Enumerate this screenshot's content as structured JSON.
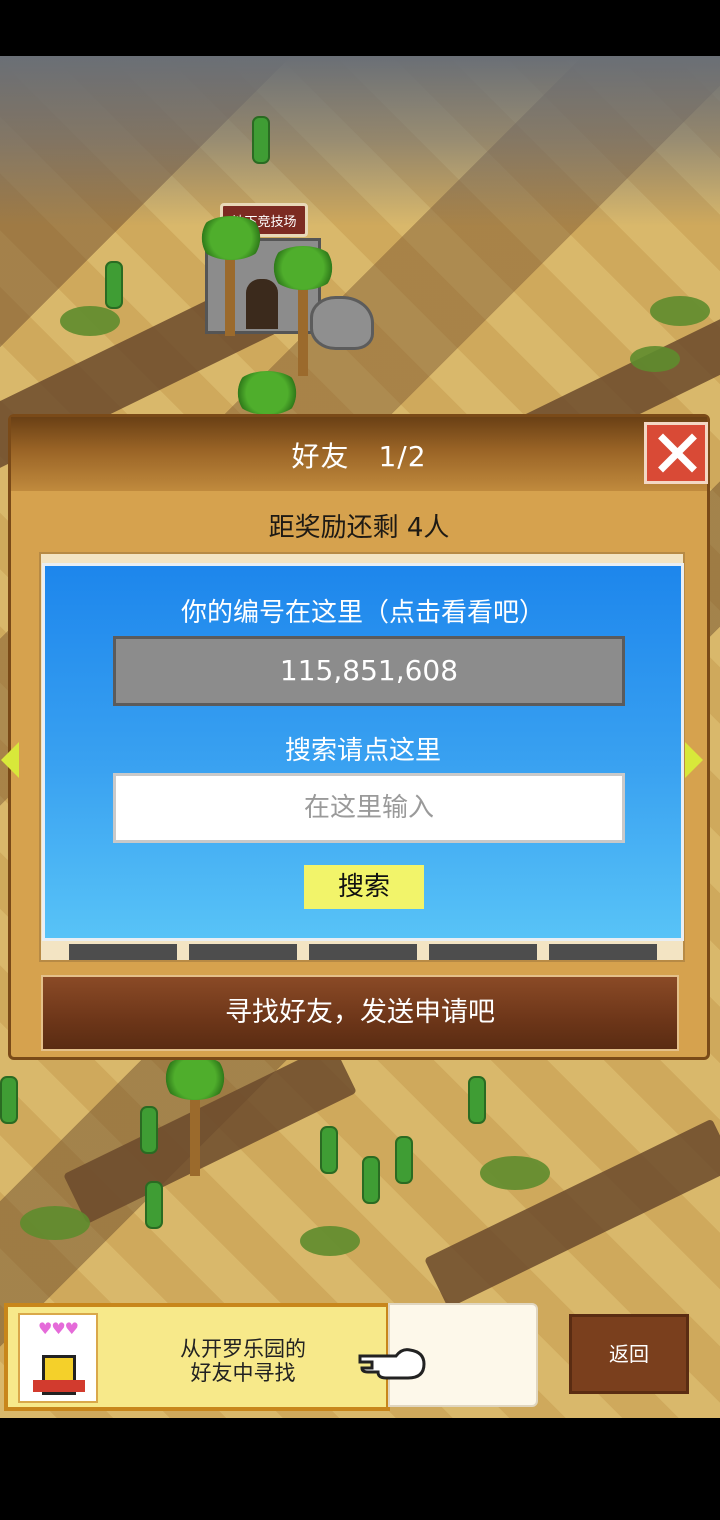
{
  "world": {
    "building_sign": "地下竞技场"
  },
  "dialog": {
    "title": "好友　1/2",
    "reward_text": "距奖励还剩 4人",
    "panel": {
      "id_label": "你的编号在这里（点击看看吧）",
      "id_value": "115,851,608",
      "search_label": "搜索请点这里",
      "search_placeholder": "在这里输入",
      "search_button": "搜索"
    },
    "find_button": "寻找好友，发送申请吧"
  },
  "banner": {
    "line1": "从开罗乐园的",
    "line2": "好友中寻找",
    "hearts": "♥♥♥"
  },
  "back_button": "返回",
  "colors": {
    "panel_blue": "#1d86ec",
    "search_button_yellow": "#f2f46a",
    "close_red": "#d94a36",
    "find_button_brown": "#6d3619"
  }
}
